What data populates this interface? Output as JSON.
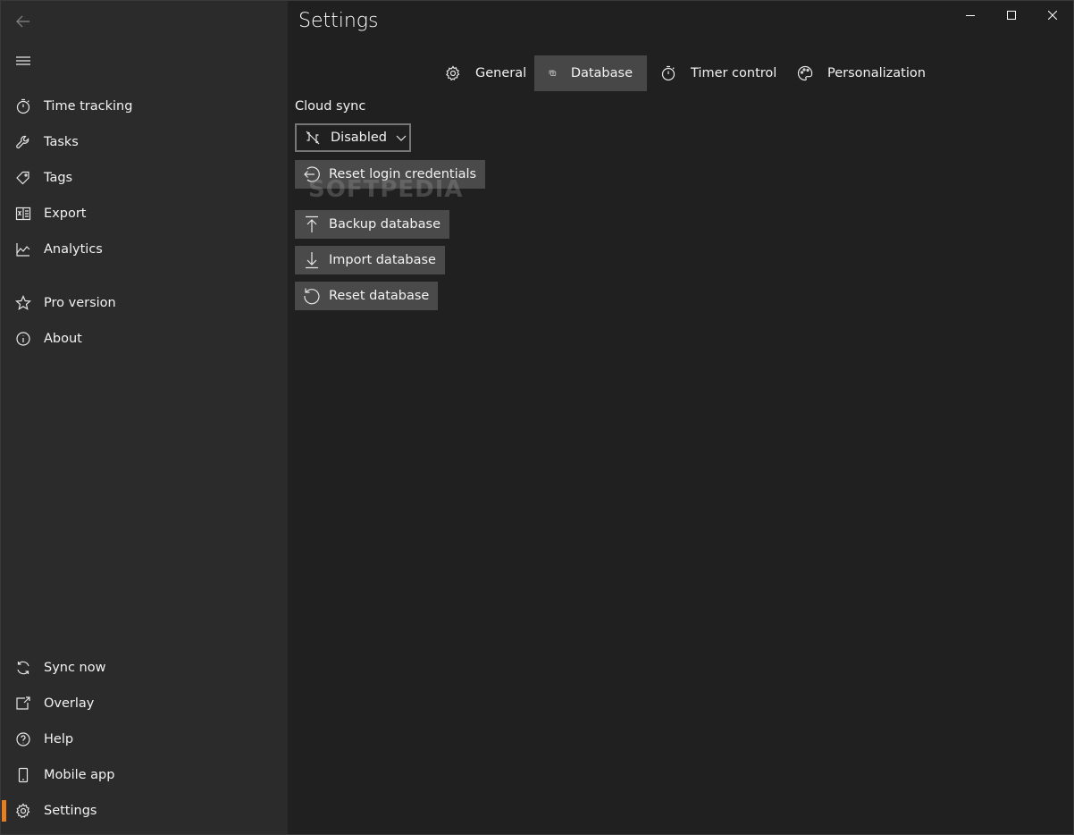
{
  "theme": {
    "accent": "#e67e22",
    "sidebar_bg": "#2b2b2b",
    "main_bg": "#202020",
    "active_tab_bg": "#474747",
    "button_bg": "#4a4a4a"
  },
  "sidebar": {
    "top_items": [
      {
        "label": "Time tracking",
        "icon": "stopwatch-icon"
      },
      {
        "label": "Tasks",
        "icon": "wrench-icon"
      },
      {
        "label": "Tags",
        "icon": "tag-icon"
      },
      {
        "label": "Export",
        "icon": "excel-icon"
      },
      {
        "label": "Analytics",
        "icon": "chart-icon"
      },
      {
        "label": "Pro version",
        "icon": "star-icon"
      },
      {
        "label": "About",
        "icon": "info-icon"
      }
    ],
    "bottom_items": [
      {
        "label": "Sync now",
        "icon": "sync-icon"
      },
      {
        "label": "Overlay",
        "icon": "overlay-icon"
      },
      {
        "label": "Help",
        "icon": "help-icon"
      },
      {
        "label": "Mobile app",
        "icon": "phone-icon"
      },
      {
        "label": "Settings",
        "icon": "gear-icon",
        "active": true
      }
    ]
  },
  "header": {
    "title": "Settings"
  },
  "tabs": [
    {
      "label": "General",
      "icon": "gear-icon"
    },
    {
      "label": "Database",
      "icon": "database-icon",
      "active": true
    },
    {
      "label": "Timer control",
      "icon": "stopwatch-icon"
    },
    {
      "label": "Personalization",
      "icon": "palette-icon"
    }
  ],
  "database": {
    "cloud_sync_label": "Cloud sync",
    "cloud_sync_value": "Disabled",
    "buttons": {
      "reset_login": "Reset login credentials",
      "backup": "Backup database",
      "import": "Import database",
      "reset_db": "Reset database"
    }
  },
  "watermark": "SOFTPEDIA"
}
